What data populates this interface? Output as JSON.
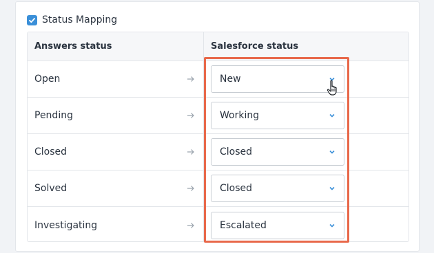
{
  "section": {
    "checkbox_checked": true,
    "title": "Status Mapping"
  },
  "table": {
    "headers": {
      "answers_status": "Answers status",
      "salesforce_status": "Salesforce status"
    },
    "rows": [
      {
        "answers": "Open",
        "salesforce": "New"
      },
      {
        "answers": "Pending",
        "salesforce": "Working"
      },
      {
        "answers": "Closed",
        "salesforce": "Closed"
      },
      {
        "answers": "Solved",
        "salesforce": "Closed"
      },
      {
        "answers": "Investigating",
        "salesforce": "Escalated"
      }
    ]
  },
  "colors": {
    "accent": "#3a8fd8",
    "highlight": "#e8684a"
  },
  "icons": {
    "row_arrow": "arrow-right-icon",
    "select_chevron": "chevron-down-icon",
    "cursor": "hand-pointer-icon",
    "checkbox": "checkmark-icon"
  }
}
